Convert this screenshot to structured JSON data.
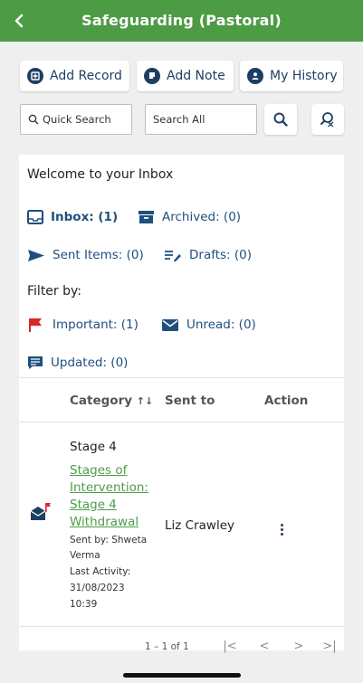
{
  "header": {
    "title": "Safeguarding (Pastoral)"
  },
  "actions": {
    "add_record": "Add Record",
    "add_note": "Add Note",
    "my_history": "My History"
  },
  "search": {
    "quick": "Quick Search",
    "all": "Search All"
  },
  "inbox": {
    "welcome": "Welcome to your Inbox",
    "inbox": "Inbox: (1)",
    "archived": "Archived: (0)",
    "sent_items": "Sent Items: (0)",
    "drafts": "Drafts: (0)",
    "filter_label": "Filter by:",
    "important": "Important: (1)",
    "unread": "Unread: (0)",
    "updated": "Updated: (0)"
  },
  "table": {
    "columns": {
      "category": "Category",
      "sort_icon": "↑↓",
      "sent_to": "Sent to",
      "action": "Action"
    },
    "rows": [
      {
        "stage": "Stage 4",
        "record_link": "Stages of Intervention: Stage 4 Withdrawal",
        "sent_by": "Sent by: Shweta Verma",
        "last_activity_label": "Last Activity:",
        "last_activity_date": "31/08/2023",
        "last_activity_time": "10:39",
        "sent_to": "Liz Crawley"
      }
    ]
  },
  "pagination": {
    "range": "1 – 1 of 1",
    "first": "|<",
    "prev": "<",
    "next": ">",
    "last": ">|"
  },
  "colors": {
    "header_green": "#4e9b46",
    "navy": "#1e3f63",
    "flag_red": "#d9262b"
  }
}
